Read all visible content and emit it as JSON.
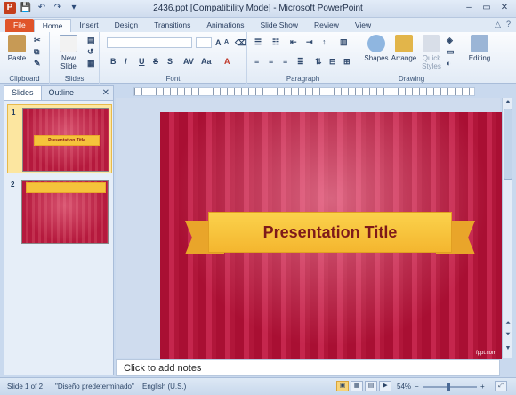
{
  "window": {
    "title": "2436.ppt [Compatibility Mode] - Microsoft PowerPoint",
    "controls": [
      "–",
      "▭",
      "✕"
    ]
  },
  "quick_access": {
    "app_icon": "P",
    "save": "💾",
    "undo": "↶",
    "redo": "↷",
    "customize": "▾"
  },
  "tabs": [
    "File",
    "Home",
    "Insert",
    "Design",
    "Transitions",
    "Animations",
    "Slide Show",
    "Review",
    "View"
  ],
  "active_tab": "Home",
  "ribbon": {
    "clipboard": {
      "paste": "Paste",
      "label": "Clipboard"
    },
    "slides": {
      "new_slide": "New Slide",
      "label": "Slides"
    },
    "font": {
      "label": "Font",
      "bold": "B",
      "italic": "I",
      "underline": "U",
      "strike": "S",
      "grow": "A",
      "shrink": "A",
      "case": "Aa"
    },
    "paragraph": {
      "label": "Paragraph"
    },
    "drawing": {
      "shapes": "Shapes",
      "arrange": "Arrange",
      "quick_styles": "Quick Styles",
      "label": "Drawing"
    },
    "editing": {
      "label": "Editing"
    }
  },
  "left_pane": {
    "tabs": [
      "Slides",
      "Outline"
    ],
    "active_tab": "Slides",
    "close": "✕",
    "slides": [
      {
        "number": "1",
        "title": "Presentation Title",
        "selected": true
      },
      {
        "number": "2",
        "title": "",
        "selected": false
      }
    ]
  },
  "ruler": {
    "marks": "4 · · · 3 · · · 2 · · · 1 · · · 0 · · · 1 · · · 2 · · · 3 · · · 4"
  },
  "slide": {
    "title": "Presentation Title",
    "watermark": "fppt.com"
  },
  "notes": {
    "placeholder": "Click to add notes"
  },
  "status": {
    "slide_info": "Slide 1 of 2",
    "theme": "\"Diseño predeterminado\"",
    "language": "English (U.S.)",
    "zoom": "54%"
  },
  "colors": {
    "accent": "#e0542a",
    "slide_red": "#b1163a",
    "banner_yellow": "#f5c33b"
  }
}
